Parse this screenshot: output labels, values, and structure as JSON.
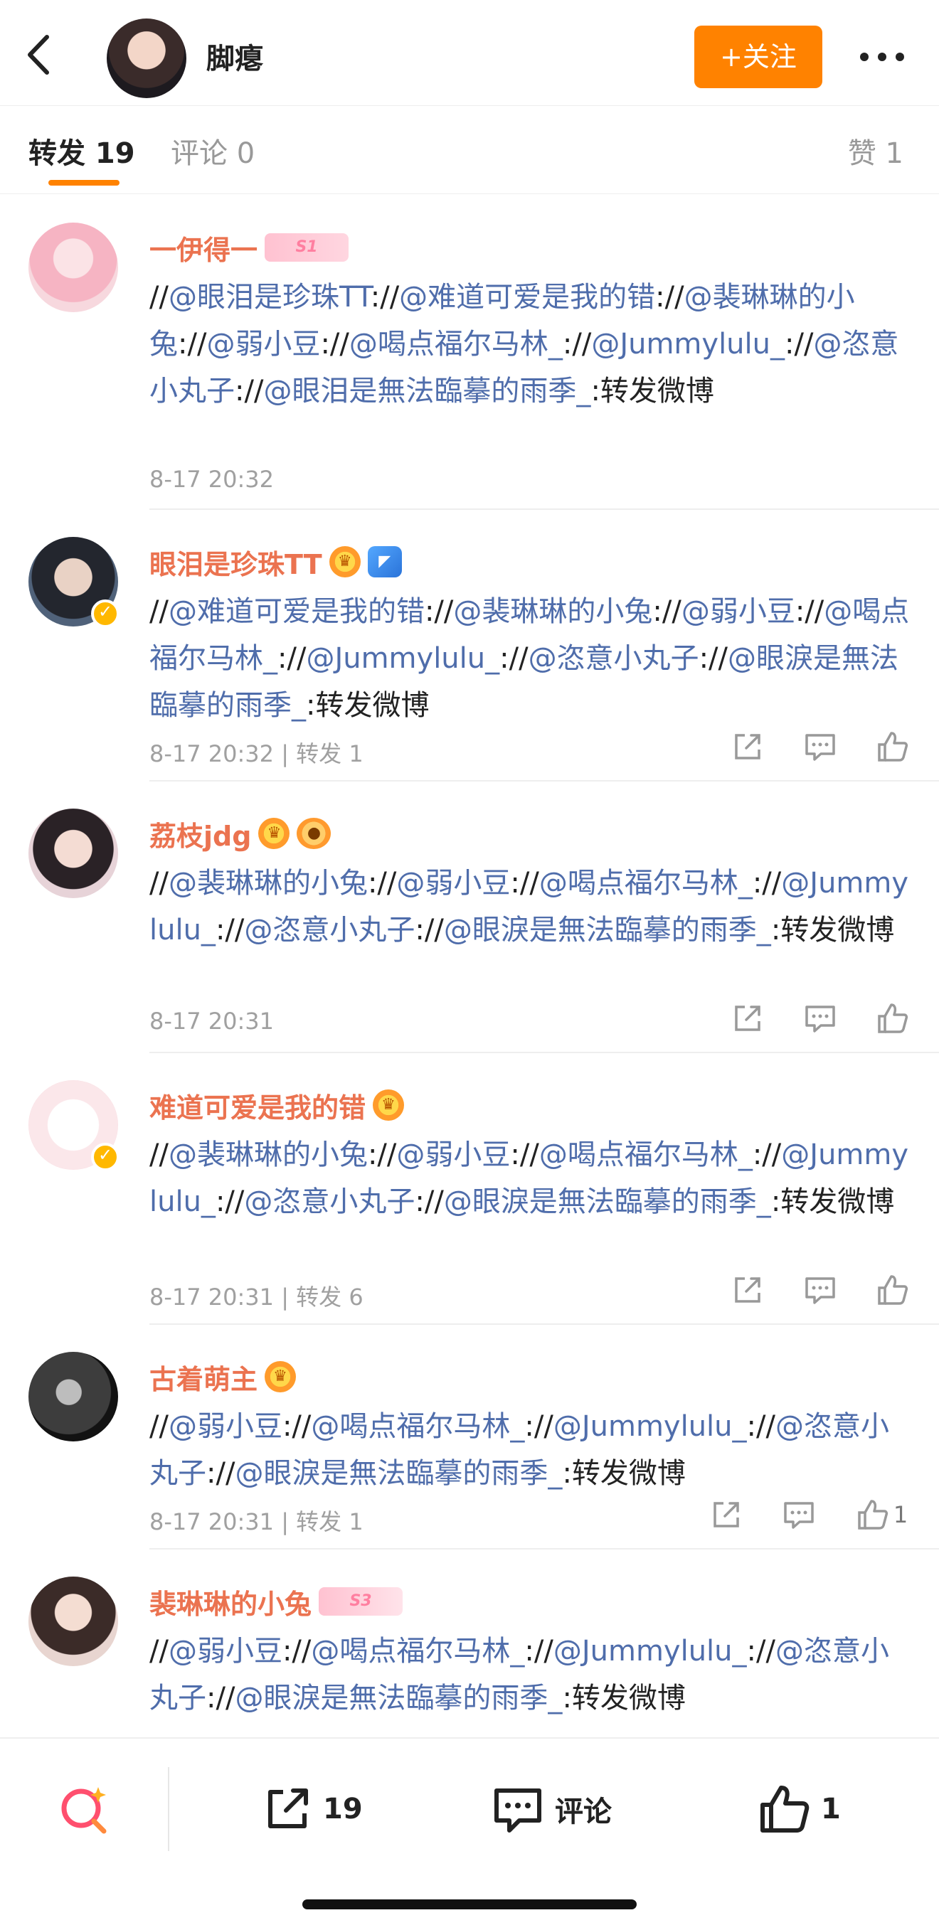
{
  "header": {
    "username": "脚瘪",
    "follow_label": "+关注"
  },
  "tabs": {
    "repost": "转发 19",
    "comment": "评论 0",
    "like": "赞 1"
  },
  "reposts": [
    {
      "name": "一伊得一",
      "badges": [
        "S1"
      ],
      "segments": [
        {
          "t": "//",
          "at": false
        },
        {
          "t": "@眼泪是珍珠TT",
          "at": true
        },
        {
          "t": "://",
          "at": false
        },
        {
          "t": "@难道可爱是我的错",
          "at": true
        },
        {
          "t": "://",
          "at": false
        },
        {
          "t": "@裴琳琳的小兔",
          "at": true
        },
        {
          "t": "://",
          "at": false
        },
        {
          "t": "@弱小豆",
          "at": true
        },
        {
          "t": "://",
          "at": false
        },
        {
          "t": "@喝点福尔马林_",
          "at": true
        },
        {
          "t": "://",
          "at": false
        },
        {
          "t": "@Jummylulu_",
          "at": true
        },
        {
          "t": "://",
          "at": false
        },
        {
          "t": "@恣意小丸子",
          "at": true
        },
        {
          "t": "://",
          "at": false
        },
        {
          "t": "@眼泪是無法臨摹的雨季_",
          "at": true
        },
        {
          "t": ":转发微博",
          "at": false
        }
      ],
      "time": "8-17 20:32",
      "repost_count": "",
      "like_count": ""
    },
    {
      "name": "眼泪是珍珠TT",
      "badges": [
        "crown",
        "shark"
      ],
      "verified": true,
      "segments": [
        {
          "t": "//",
          "at": false
        },
        {
          "t": "@难道可爱是我的错",
          "at": true
        },
        {
          "t": "://",
          "at": false
        },
        {
          "t": "@裴琳琳的小兔",
          "at": true
        },
        {
          "t": "://",
          "at": false
        },
        {
          "t": "@弱小豆",
          "at": true
        },
        {
          "t": "://",
          "at": false
        },
        {
          "t": "@喝点福尔马林_",
          "at": true
        },
        {
          "t": "://",
          "at": false
        },
        {
          "t": "@Jummylulu_",
          "at": true
        },
        {
          "t": "://",
          "at": false
        },
        {
          "t": "@恣意小丸子",
          "at": true
        },
        {
          "t": "://",
          "at": false
        },
        {
          "t": "@眼淚是無法臨摹的雨季_",
          "at": true
        },
        {
          "t": ":转发微博",
          "at": false
        }
      ],
      "time": "8-17 20:32",
      "repost_count": "转发 1",
      "like_count": ""
    },
    {
      "name": "荔枝jdg",
      "badges": [
        "crown",
        "fish"
      ],
      "segments": [
        {
          "t": "//",
          "at": false
        },
        {
          "t": "@裴琳琳的小兔",
          "at": true
        },
        {
          "t": "://",
          "at": false
        },
        {
          "t": "@弱小豆",
          "at": true
        },
        {
          "t": "://",
          "at": false
        },
        {
          "t": "@喝点福尔马林_",
          "at": true
        },
        {
          "t": "://",
          "at": false
        },
        {
          "t": "@Jummylulu_",
          "at": true
        },
        {
          "t": "://",
          "at": false
        },
        {
          "t": "@恣意小丸子",
          "at": true
        },
        {
          "t": "://",
          "at": false
        },
        {
          "t": "@眼淚是無法臨摹的雨季_",
          "at": true
        },
        {
          "t": ":转发微博",
          "at": false
        }
      ],
      "time": "8-17 20:31",
      "repost_count": "",
      "like_count": ""
    },
    {
      "name": "难道可爱是我的错",
      "badges": [
        "crown"
      ],
      "verified": true,
      "segments": [
        {
          "t": "//",
          "at": false
        },
        {
          "t": "@裴琳琳的小兔",
          "at": true
        },
        {
          "t": "://",
          "at": false
        },
        {
          "t": "@弱小豆",
          "at": true
        },
        {
          "t": "://",
          "at": false
        },
        {
          "t": "@喝点福尔马林_",
          "at": true
        },
        {
          "t": "://",
          "at": false
        },
        {
          "t": "@Jummylulu_",
          "at": true
        },
        {
          "t": "://",
          "at": false
        },
        {
          "t": "@恣意小丸子",
          "at": true
        },
        {
          "t": "://",
          "at": false
        },
        {
          "t": "@眼淚是無法臨摹的雨季_",
          "at": true
        },
        {
          "t": ":转发微博",
          "at": false
        }
      ],
      "time": "8-17 20:31",
      "repost_count": "转发 6",
      "like_count": ""
    },
    {
      "name": "古着萌主",
      "badges": [
        "crown"
      ],
      "segments": [
        {
          "t": "//",
          "at": false
        },
        {
          "t": "@弱小豆",
          "at": true
        },
        {
          "t": "://",
          "at": false
        },
        {
          "t": "@喝点福尔马林_",
          "at": true
        },
        {
          "t": "://",
          "at": false
        },
        {
          "t": "@Jummylulu_",
          "at": true
        },
        {
          "t": "://",
          "at": false
        },
        {
          "t": "@恣意小丸子",
          "at": true
        },
        {
          "t": "://",
          "at": false
        },
        {
          "t": "@眼淚是無法臨摹的雨季_",
          "at": true
        },
        {
          "t": ":转发微博",
          "at": false
        }
      ],
      "time": "8-17 20:31",
      "repost_count": "转发 1",
      "like_count": "1"
    },
    {
      "name": "裴琳琳的小兔",
      "badges": [
        "S3"
      ],
      "segments": [
        {
          "t": "//",
          "at": false
        },
        {
          "t": "@弱小豆",
          "at": true
        },
        {
          "t": "://",
          "at": false
        },
        {
          "t": "@喝点福尔马林_",
          "at": true
        },
        {
          "t": "://",
          "at": false
        },
        {
          "t": "@Jummylulu_",
          "at": true
        },
        {
          "t": "://",
          "at": false
        },
        {
          "t": "@恣意小丸子",
          "at": true
        },
        {
          "t": "://",
          "at": false
        },
        {
          "t": "@眼淚是無法臨摹的雨季_",
          "at": true
        },
        {
          "t": ":转发微博",
          "at": false
        }
      ],
      "time": "",
      "repost_count": "",
      "like_count": ""
    }
  ],
  "bottom_bar": {
    "repost_count": "19",
    "comment_label": "评论",
    "like_count": "1"
  }
}
